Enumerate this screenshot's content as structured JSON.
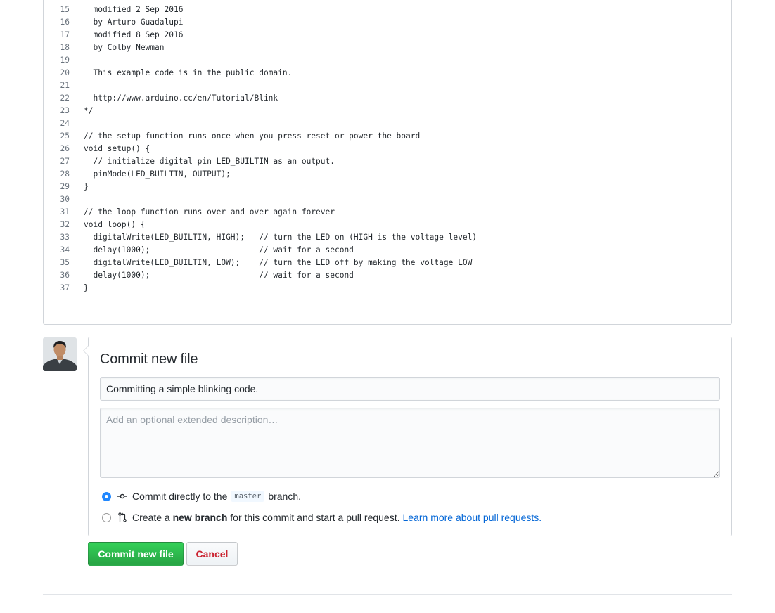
{
  "code": {
    "lines": [
      {
        "num": "15",
        "text": "  modified 2 Sep 2016"
      },
      {
        "num": "16",
        "text": "  by Arturo Guadalupi"
      },
      {
        "num": "17",
        "text": "  modified 8 Sep 2016"
      },
      {
        "num": "18",
        "text": "  by Colby Newman"
      },
      {
        "num": "19",
        "text": ""
      },
      {
        "num": "20",
        "text": "  This example code is in the public domain."
      },
      {
        "num": "21",
        "text": ""
      },
      {
        "num": "22",
        "text": "  http://www.arduino.cc/en/Tutorial/Blink"
      },
      {
        "num": "23",
        "text": "*/"
      },
      {
        "num": "24",
        "text": ""
      },
      {
        "num": "25",
        "text": "// the setup function runs once when you press reset or power the board"
      },
      {
        "num": "26",
        "text": "void setup() {"
      },
      {
        "num": "27",
        "text": "  // initialize digital pin LED_BUILTIN as an output."
      },
      {
        "num": "28",
        "text": "  pinMode(LED_BUILTIN, OUTPUT);"
      },
      {
        "num": "29",
        "text": "}"
      },
      {
        "num": "30",
        "text": ""
      },
      {
        "num": "31",
        "text": "// the loop function runs over and over again forever"
      },
      {
        "num": "32",
        "text": "void loop() {"
      },
      {
        "num": "33",
        "text": "  digitalWrite(LED_BUILTIN, HIGH);   // turn the LED on (HIGH is the voltage level)"
      },
      {
        "num": "34",
        "text": "  delay(1000);                       // wait for a second"
      },
      {
        "num": "35",
        "text": "  digitalWrite(LED_BUILTIN, LOW);    // turn the LED off by making the voltage LOW"
      },
      {
        "num": "36",
        "text": "  delay(1000);                       // wait for a second"
      },
      {
        "num": "37",
        "text": "}"
      }
    ]
  },
  "commit": {
    "title": "Commit new file",
    "summary_value": "Committing a simple blinking code.",
    "description_placeholder": "Add an optional extended description…",
    "option_direct": {
      "prefix": "Commit directly to the",
      "branch": "master",
      "suffix": "branch."
    },
    "option_new_branch": {
      "prefix": "Create a",
      "bold": "new branch",
      "suffix": "for this commit and start a pull request.",
      "link": "Learn more about pull requests."
    },
    "submit_label": "Commit new file",
    "cancel_label": "Cancel"
  },
  "colors": {
    "primary_button": "#28a745",
    "cancel_text": "#cb2431",
    "link": "#0366d6",
    "radio_checked": "#2188ff"
  },
  "icons": {
    "commit": "git-commit-icon",
    "pull_request": "git-pull-request-icon"
  }
}
